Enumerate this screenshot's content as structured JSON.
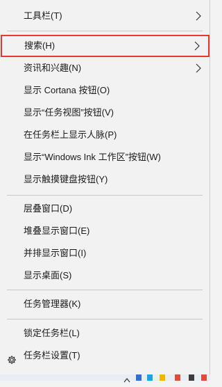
{
  "menu": {
    "items": [
      {
        "label": "工具栏(T)"
      },
      {
        "label": "搜索(H)"
      },
      {
        "label": "资讯和兴趣(N)"
      },
      {
        "label": "显示 Cortana 按钮(O)"
      },
      {
        "label": "显示“任务视图”按钮(V)"
      },
      {
        "label": "在任务栏上显示人脉(P)"
      },
      {
        "label": "显示“Windows Ink 工作区”按钮(W)"
      },
      {
        "label": "显示触摸键盘按钮(Y)"
      },
      {
        "label": "层叠窗口(D)"
      },
      {
        "label": "堆叠显示窗口(E)"
      },
      {
        "label": "并排显示窗口(I)"
      },
      {
        "label": "显示桌面(S)"
      },
      {
        "label": "任务管理器(K)"
      },
      {
        "label": "锁定任务栏(L)"
      },
      {
        "label": "任务栏设置(T)"
      }
    ]
  },
  "icons": {
    "submenu_arrow": "chevron-right-icon",
    "settings": "gear-icon",
    "taskbar_tray_up": "chevron-up-icon"
  },
  "colors": {
    "menu_background": "#f2f2f2",
    "highlight_border": "#e53935",
    "separator": "#c8c8c8",
    "text": "#1a1a1a"
  }
}
